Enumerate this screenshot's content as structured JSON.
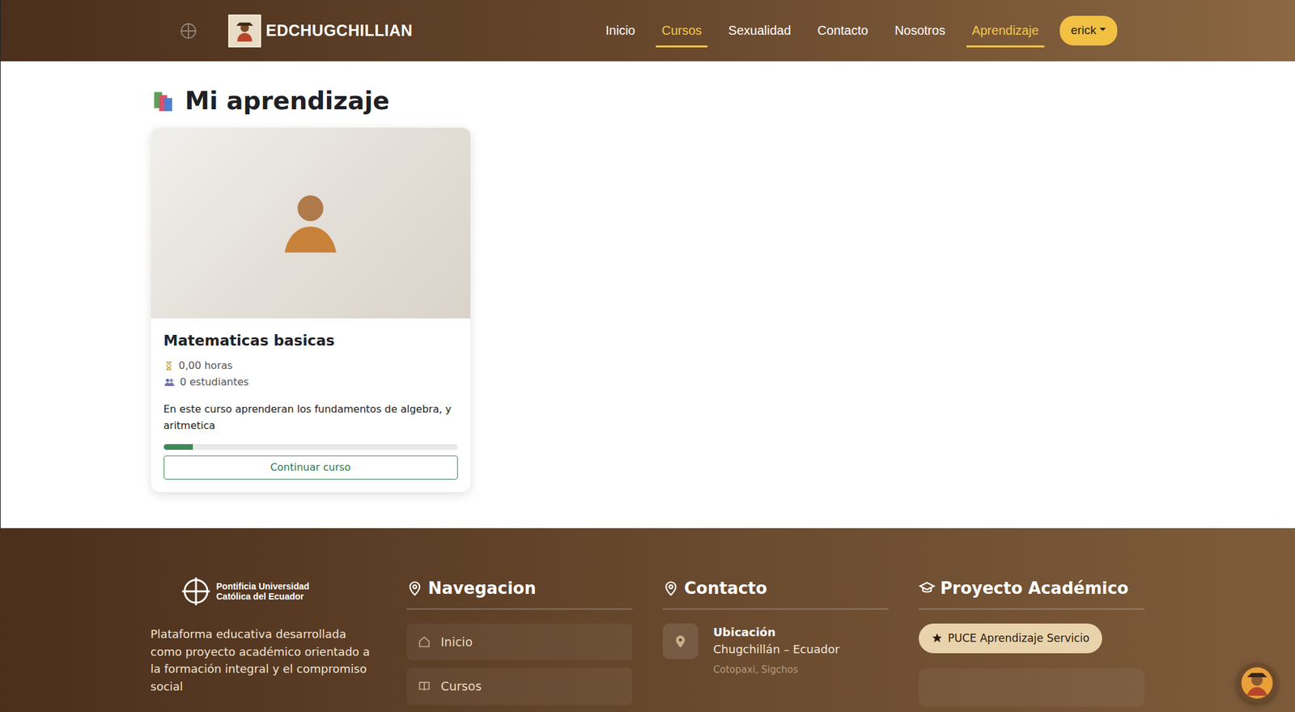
{
  "brand": {
    "name": "EDCHUGCHILLIAN"
  },
  "nav": [
    {
      "label": "Inicio",
      "selected": false
    },
    {
      "label": "Cursos",
      "selected": true
    },
    {
      "label": "Sexualidad",
      "selected": false
    },
    {
      "label": "Contacto",
      "selected": false
    },
    {
      "label": "Nosotros",
      "selected": false
    },
    {
      "label": "Aprendizaje",
      "selected": true
    }
  ],
  "user": {
    "name": "erick"
  },
  "page": {
    "title": "Mi aprendizaje"
  },
  "courses": [
    {
      "title": "Matematicas basicas",
      "hours": "0,00 horas",
      "students": "0 estudiantes",
      "description": "En este curso aprenderan los fundamentos de algebra, y aritmetica",
      "level": 0.1,
      "button": "Continuar curso"
    }
  ],
  "footer": {
    "logo_text": "Pontificia Universidad Católica del Ecuador",
    "about": "Plataforma educativa desarrollada como proyecto académico orientado a la formación integral y el compromiso social",
    "nav_title": "Navegacion",
    "nav_items": [
      "Inicio",
      "Cursos"
    ],
    "contact_title": "Contacto",
    "contact_items": [
      {
        "label": "Ubicación",
        "value": "Chugchillán – Ecuador",
        "sub": "Cotopaxi, Sigchos"
      }
    ],
    "project_title": "Proyecto Académico",
    "project_badge": "PUCE Aprendizaje Servicio"
  }
}
